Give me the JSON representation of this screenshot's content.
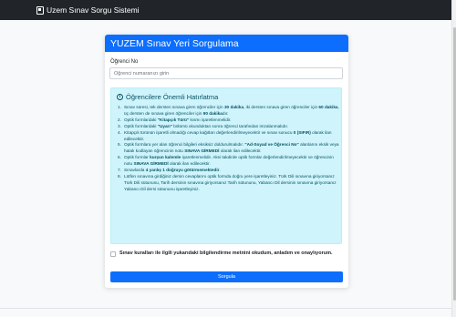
{
  "navbar": {
    "brand": "Uzem Sınav Sorgu Sistemi",
    "icon": "document-icon"
  },
  "card": {
    "title": "YUZEM Sınav Yeri Sorgulama",
    "student_label": "Öğrenci No",
    "student_placeholder": "Öğrenci numaranızı girin",
    "student_value": "",
    "alert": {
      "title": "Öğrencilere Önemli Hatırlatma",
      "icon": "info-icon",
      "rules": [
        {
          "num": "1.",
          "parts": [
            {
              "t": "Sınav süresi, tek dersten sınava giren öğrenciler için "
            },
            {
              "t": "30 dakika",
              "b": true
            },
            {
              "t": ", iki dersten sınava giren öğrenciler için "
            },
            {
              "t": "60 dakika",
              "b": true
            },
            {
              "t": ", üç dersten de sınava giren öğrenciler için "
            },
            {
              "t": "90 dakika",
              "b": true
            },
            {
              "t": "dır."
            }
          ]
        },
        {
          "num": "2.",
          "parts": [
            {
              "t": "Optik formlardaki "
            },
            {
              "t": "\"Kitapçık Türü\"",
              "b": true
            },
            {
              "t": " kısmı işaretlenmelidir."
            }
          ]
        },
        {
          "num": "3.",
          "parts": [
            {
              "t": "Optik formlardaki "
            },
            {
              "t": "\"Uyarı\"",
              "b": true
            },
            {
              "t": " bölümü okunduktan sonra öğrenci tarafından imzalanmalıdır."
            }
          ]
        },
        {
          "num": "4.",
          "parts": [
            {
              "t": "Kitapçık türünün işaretli olmadığı cevap kağıtları değerlendirilmeyecektir ve sınav sonucu "
            },
            {
              "t": "0 (SIFIR)",
              "b": true
            },
            {
              "t": " olarak ilan edilecektir."
            }
          ]
        },
        {
          "num": "5.",
          "parts": [
            {
              "t": "Optik formlara yer alan öğrenci bilgileri eksiksiz doldurulmalıdır. "
            },
            {
              "t": "\"Ad-Soyad ve Öğrenci No\"",
              "b": true
            },
            {
              "t": " alanlarını eksik veya hatalı kodlayan öğrencinin notu "
            },
            {
              "t": "SINAVA GİRMEDİ",
              "b": true
            },
            {
              "t": " olarak ilan edilecektir."
            }
          ]
        },
        {
          "num": "6.",
          "parts": [
            {
              "t": "Optik formlar "
            },
            {
              "t": "kurşun kalemle",
              "b": true
            },
            {
              "t": " işaretlenmelidir. Aksi takdirde optik formlar değerlendirilmeyecektir ve öğrencinin notu "
            },
            {
              "t": "SINAVA GİRMEDİ",
              "b": true
            },
            {
              "t": " olarak ilan edilecektir."
            }
          ]
        },
        {
          "num": "7.",
          "parts": [
            {
              "t": "Sınavlarda "
            },
            {
              "t": "4 yanlış 1 doğruyu götürmemektedir",
              "b": true
            },
            {
              "t": "."
            }
          ]
        },
        {
          "num": "8.",
          "parts": [
            {
              "t": "Lütfen sınavına girdiğiniz dersin cevaplarını optik formda doğru yere işaretleyiniz. Türk Dili sınavına giriyorsanız Türk Dili sütununu, Tarih dersinin sınavına giriyorsanız Tarih sütununu, Yabancı Dil dersinin sınavına giriyorsanız Yabancı Dil dersi sütununu işaretleyiniz."
            }
          ]
        }
      ]
    },
    "agree_label": "Sınav kuralları ile ilgili yukarıdaki bilgilendirme metnini okudum, anladım ve onaylıyorum.",
    "agree_checked": false,
    "submit_label": "Sorgula"
  },
  "colors": {
    "navbar": "#212529",
    "primary": "#0d6efd",
    "alert_bg": "#cff4fc",
    "alert_text": "#055160"
  }
}
